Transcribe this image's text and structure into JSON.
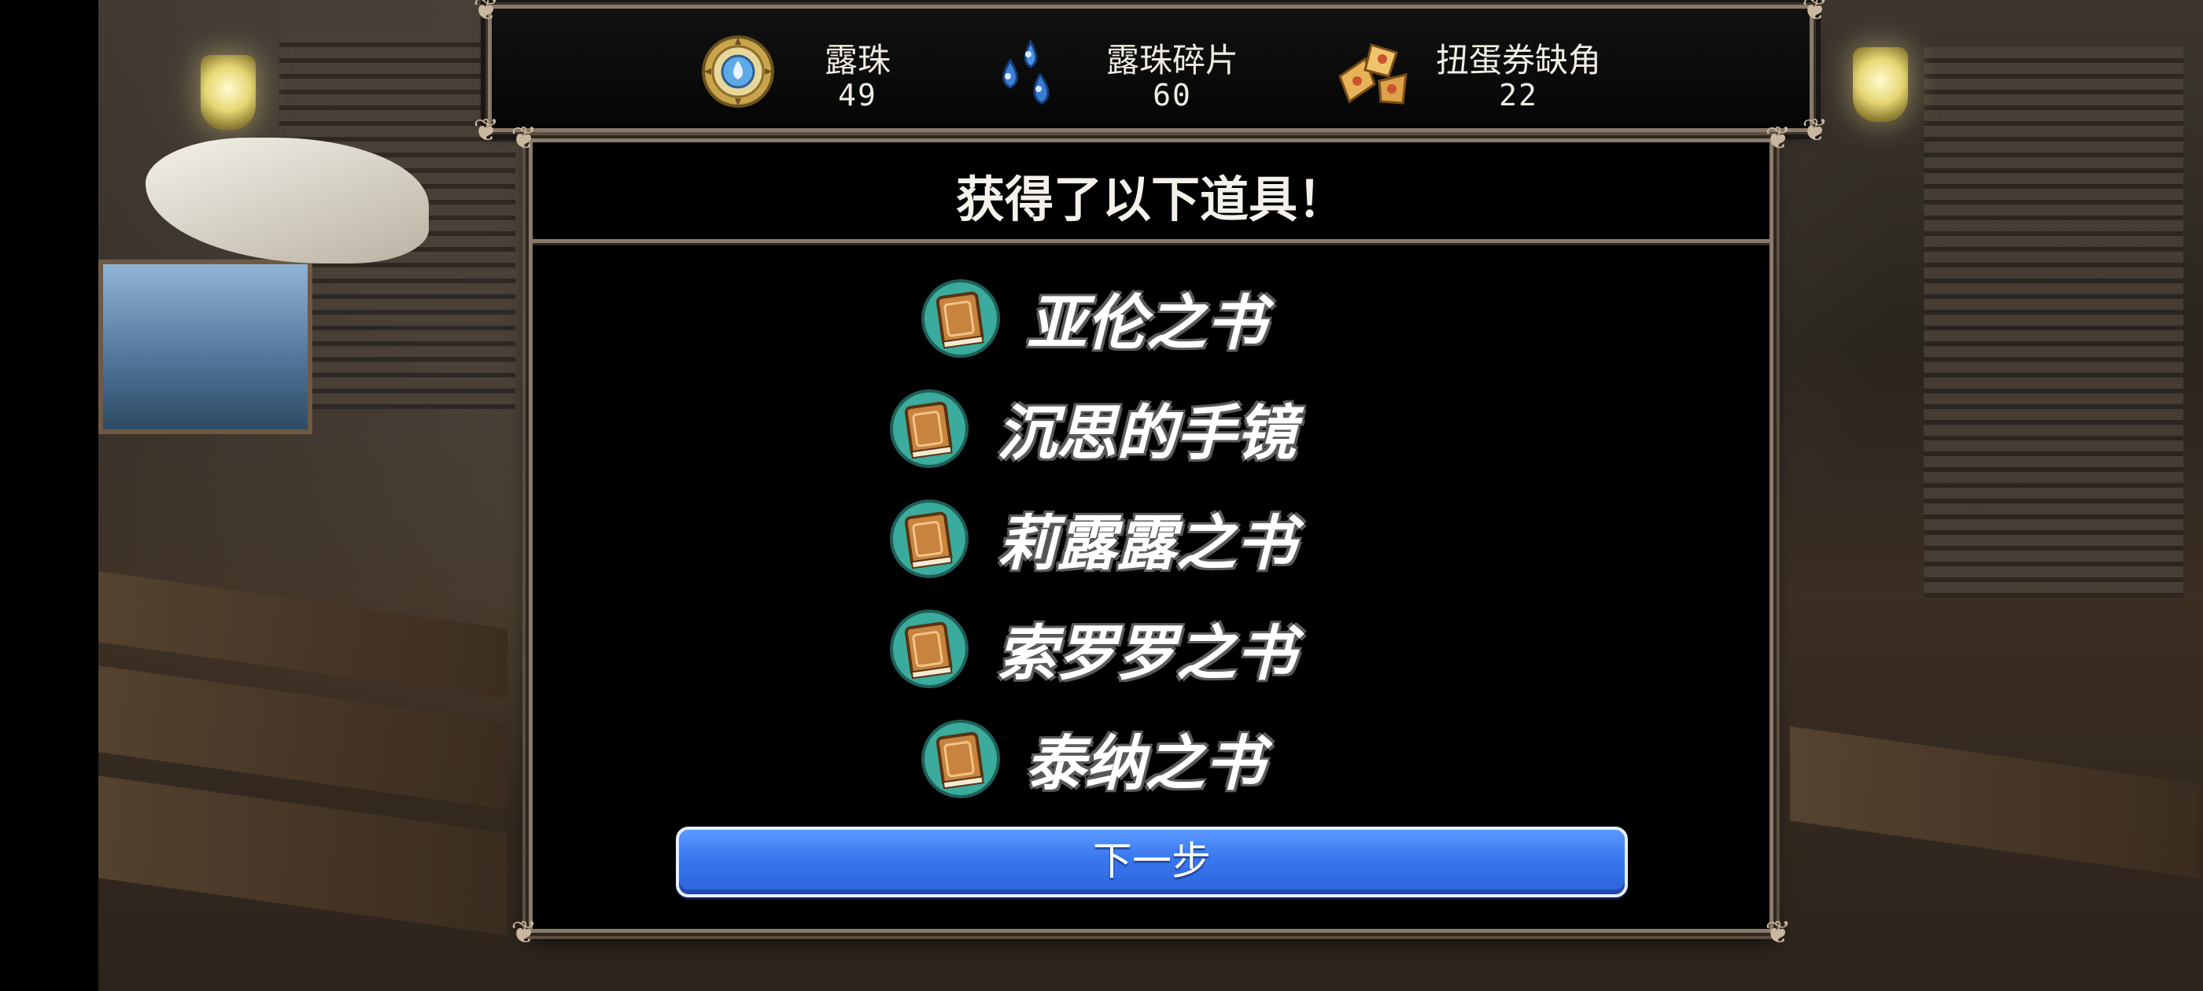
{
  "currency_bar": {
    "items": [
      {
        "name": "露珠",
        "value": "49",
        "icon": "dew-orb-icon"
      },
      {
        "name": "露珠碎片",
        "value": "60",
        "icon": "dew-shard-icon"
      },
      {
        "name": "扭蛋券缺角",
        "value": "22",
        "icon": "gacha-ticket-fragment-icon"
      }
    ]
  },
  "dialog": {
    "title": "获得了以下道具！",
    "rewards": [
      {
        "name": "亚伦之书",
        "icon": "book-icon"
      },
      {
        "name": "沉思的手镜",
        "icon": "book-icon"
      },
      {
        "name": "莉露露之书",
        "icon": "book-icon"
      },
      {
        "name": "索罗罗之书",
        "icon": "book-icon"
      },
      {
        "name": "泰纳之书",
        "icon": "book-icon"
      }
    ],
    "next_label": "下一步"
  },
  "colors": {
    "frame_border": "#8a7a6a",
    "button_blue": "#3977f0",
    "book_glow": "#3fb8a8",
    "book_cover": "#c8843f"
  }
}
